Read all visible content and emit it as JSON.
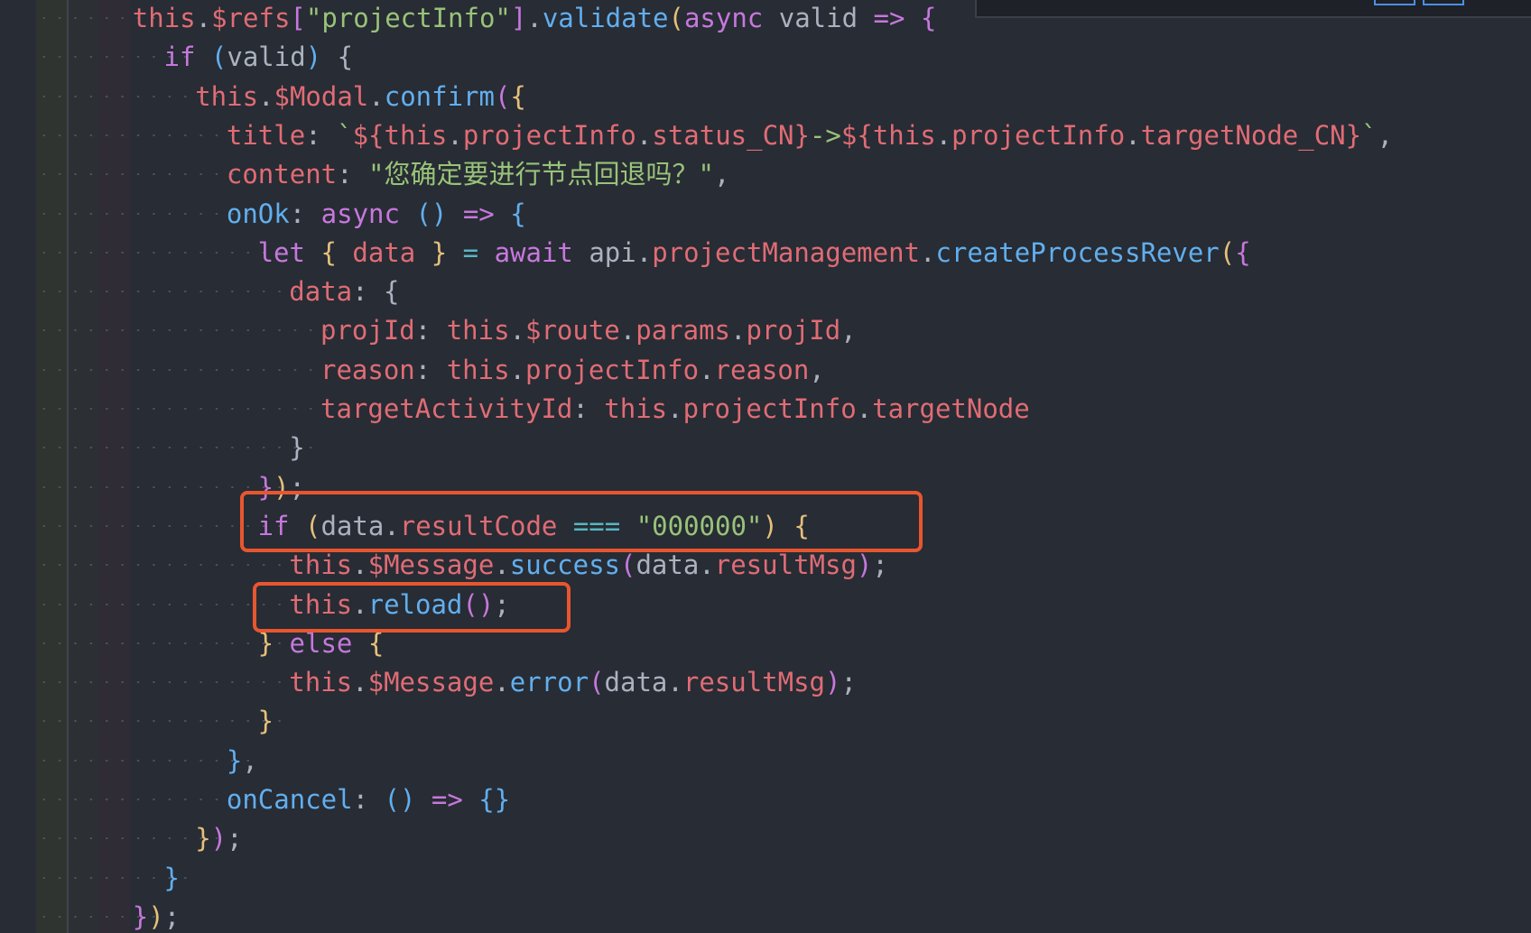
{
  "editor": {
    "language": "javascript",
    "theme_colors": {
      "background": "#282c34",
      "keyword": "#c678dd",
      "this": "#e06c75",
      "property": "#e06c75",
      "function": "#61afef",
      "string": "#98c379",
      "operator": "#56b6c2",
      "bracket_level1": "#e5c07b",
      "bracket_level2": "#c678dd",
      "bracket_level3": "#61afef",
      "highlight_box": "#e8562f"
    },
    "lines": [
      {
        "indent": 4,
        "tokens": [
          [
            "th",
            "this"
          ],
          [
            "pn",
            "."
          ],
          [
            "pr",
            "$refs"
          ],
          [
            "b2",
            "["
          ],
          [
            "st",
            "\"projectInfo\""
          ],
          [
            "b2",
            "]"
          ],
          [
            "pn",
            "."
          ],
          [
            "fn",
            "validate"
          ],
          [
            "b1",
            "("
          ],
          [
            "kw",
            "async"
          ],
          [
            "pn",
            " valid "
          ],
          [
            "kw",
            "=>"
          ],
          [
            "pn",
            " "
          ],
          [
            "b2",
            "{"
          ]
        ]
      },
      {
        "indent": 5,
        "tokens": [
          [
            "kw",
            "if"
          ],
          [
            "pn",
            " "
          ],
          [
            "b3",
            "("
          ],
          [
            "pn",
            "valid"
          ],
          [
            "b3",
            ")"
          ],
          [
            "pn",
            " {"
          ]
        ]
      },
      {
        "indent": 6,
        "tokens": [
          [
            "th",
            "this"
          ],
          [
            "pn",
            "."
          ],
          [
            "pr",
            "$Modal"
          ],
          [
            "pn",
            "."
          ],
          [
            "fn",
            "confirm"
          ],
          [
            "b2",
            "("
          ],
          [
            "b1",
            "{"
          ]
        ]
      },
      {
        "indent": 7,
        "tokens": [
          [
            "pr",
            "title"
          ],
          [
            "pn",
            ": "
          ],
          [
            "st",
            "`"
          ],
          [
            "tp",
            "${"
          ],
          [
            "th",
            "this"
          ],
          [
            "pn",
            "."
          ],
          [
            "pr",
            "projectInfo"
          ],
          [
            "pn",
            "."
          ],
          [
            "pr",
            "status_CN"
          ],
          [
            "tp",
            "}"
          ],
          [
            "st",
            "->"
          ],
          [
            "tp",
            "${"
          ],
          [
            "th",
            "this"
          ],
          [
            "pn",
            "."
          ],
          [
            "pr",
            "projectInfo"
          ],
          [
            "pn",
            "."
          ],
          [
            "pr",
            "targetNode_CN"
          ],
          [
            "tp",
            "}"
          ],
          [
            "st",
            "`"
          ],
          [
            "pn",
            ","
          ]
        ]
      },
      {
        "indent": 7,
        "tokens": [
          [
            "pr",
            "content"
          ],
          [
            "pn",
            ": "
          ],
          [
            "st",
            "\"您确定要进行节点回退吗？\""
          ],
          [
            "pn",
            ","
          ]
        ]
      },
      {
        "indent": 7,
        "tokens": [
          [
            "fn",
            "onOk"
          ],
          [
            "pn",
            ": "
          ],
          [
            "kw",
            "async"
          ],
          [
            "pn",
            " "
          ],
          [
            "b3",
            "()"
          ],
          [
            "pn",
            " "
          ],
          [
            "kw",
            "=>"
          ],
          [
            "pn",
            " "
          ],
          [
            "b3",
            "{"
          ]
        ]
      },
      {
        "indent": 8,
        "tokens": [
          [
            "kw",
            "let"
          ],
          [
            "pn",
            " "
          ],
          [
            "b1",
            "{"
          ],
          [
            "pr",
            " data "
          ],
          [
            "b1",
            "}"
          ],
          [
            "pn",
            " "
          ],
          [
            "op",
            "="
          ],
          [
            "pn",
            " "
          ],
          [
            "kw",
            "await"
          ],
          [
            "pn",
            " api."
          ],
          [
            "pr",
            "projectManagement"
          ],
          [
            "pn",
            "."
          ],
          [
            "fn",
            "createProcessRever"
          ],
          [
            "b1",
            "("
          ],
          [
            "b2",
            "{"
          ]
        ]
      },
      {
        "indent": 9,
        "tokens": [
          [
            "pr",
            "data"
          ],
          [
            "pn",
            ": {"
          ]
        ]
      },
      {
        "indent": 10,
        "tokens": [
          [
            "pr",
            "projId"
          ],
          [
            "pn",
            ": "
          ],
          [
            "th",
            "this"
          ],
          [
            "pn",
            "."
          ],
          [
            "pr",
            "$route"
          ],
          [
            "pn",
            "."
          ],
          [
            "pr",
            "params"
          ],
          [
            "pn",
            "."
          ],
          [
            "pr",
            "projId"
          ],
          [
            "pn",
            ","
          ]
        ]
      },
      {
        "indent": 10,
        "tokens": [
          [
            "pr",
            "reason"
          ],
          [
            "pn",
            ": "
          ],
          [
            "th",
            "this"
          ],
          [
            "pn",
            "."
          ],
          [
            "pr",
            "projectInfo"
          ],
          [
            "pn",
            "."
          ],
          [
            "pr",
            "reason"
          ],
          [
            "pn",
            ","
          ]
        ]
      },
      {
        "indent": 10,
        "tokens": [
          [
            "pr",
            "targetActivityId"
          ],
          [
            "pn",
            ": "
          ],
          [
            "th",
            "this"
          ],
          [
            "pn",
            "."
          ],
          [
            "pr",
            "projectInfo"
          ],
          [
            "pn",
            "."
          ],
          [
            "pr",
            "targetNode"
          ]
        ]
      },
      {
        "indent": 9,
        "tokens": [
          [
            "pn",
            "}"
          ]
        ]
      },
      {
        "indent": 8,
        "tokens": [
          [
            "b2",
            "}"
          ],
          [
            "b1",
            ")"
          ],
          [
            "pn",
            ";"
          ]
        ]
      },
      {
        "indent": 8,
        "tokens": [
          [
            "kw",
            "if"
          ],
          [
            "pn",
            " "
          ],
          [
            "b1",
            "("
          ],
          [
            "pn",
            "data."
          ],
          [
            "pr",
            "resultCode"
          ],
          [
            "pn",
            " "
          ],
          [
            "op",
            "==="
          ],
          [
            "pn",
            " "
          ],
          [
            "st",
            "\"000000\""
          ],
          [
            "b1",
            ")"
          ],
          [
            "pn",
            " "
          ],
          [
            "b1",
            "{"
          ]
        ]
      },
      {
        "indent": 9,
        "tokens": [
          [
            "th",
            "this"
          ],
          [
            "pn",
            "."
          ],
          [
            "pr",
            "$Message"
          ],
          [
            "pn",
            "."
          ],
          [
            "fn",
            "success"
          ],
          [
            "b2",
            "("
          ],
          [
            "pn",
            "data."
          ],
          [
            "pr",
            "resultMsg"
          ],
          [
            "b2",
            ")"
          ],
          [
            "pn",
            ";"
          ]
        ]
      },
      {
        "indent": 9,
        "tokens": [
          [
            "th",
            "this"
          ],
          [
            "pn",
            "."
          ],
          [
            "fn",
            "reload"
          ],
          [
            "b2",
            "()"
          ],
          [
            "pn",
            ";"
          ]
        ]
      },
      {
        "indent": 8,
        "tokens": [
          [
            "b1",
            "}"
          ],
          [
            "pn",
            " "
          ],
          [
            "kw",
            "else"
          ],
          [
            "pn",
            " "
          ],
          [
            "b1",
            "{"
          ]
        ]
      },
      {
        "indent": 9,
        "tokens": [
          [
            "th",
            "this"
          ],
          [
            "pn",
            "."
          ],
          [
            "pr",
            "$Message"
          ],
          [
            "pn",
            "."
          ],
          [
            "fn",
            "error"
          ],
          [
            "b2",
            "("
          ],
          [
            "pn",
            "data."
          ],
          [
            "pr",
            "resultMsg"
          ],
          [
            "b2",
            ")"
          ],
          [
            "pn",
            ";"
          ]
        ]
      },
      {
        "indent": 8,
        "tokens": [
          [
            "b1",
            "}"
          ]
        ]
      },
      {
        "indent": 7,
        "tokens": [
          [
            "b3",
            "}"
          ],
          [
            "pn",
            ","
          ]
        ]
      },
      {
        "indent": 7,
        "tokens": [
          [
            "fn",
            "onCancel"
          ],
          [
            "pn",
            ": "
          ],
          [
            "b3",
            "()"
          ],
          [
            "pn",
            " "
          ],
          [
            "kw",
            "=>"
          ],
          [
            "pn",
            " "
          ],
          [
            "b3",
            "{}"
          ]
        ]
      },
      {
        "indent": 6,
        "tokens": [
          [
            "b1",
            "}"
          ],
          [
            "b2",
            ")"
          ],
          [
            "pn",
            ";"
          ]
        ]
      },
      {
        "indent": 5,
        "tokens": [
          [
            "b3",
            "}"
          ]
        ]
      },
      {
        "indent": 4,
        "tokens": [
          [
            "b2",
            "}"
          ],
          [
            "b1",
            ")"
          ],
          [
            "pn",
            ";"
          ]
        ]
      }
    ],
    "highlights": [
      {
        "label": "if-resultcode-highlight",
        "line": 13
      },
      {
        "label": "reload-call-highlight",
        "line": 15
      }
    ]
  }
}
